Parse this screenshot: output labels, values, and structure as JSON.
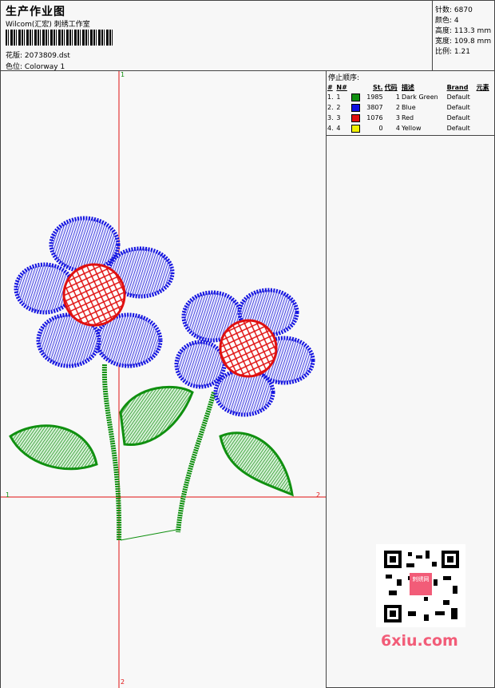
{
  "header": {
    "title": "生产作业图",
    "subtitle": "Wilcom(汇宏) 刺绣工作室",
    "design_label": "花版:",
    "design_value": "2073809.dst",
    "colorway_label": "色位:",
    "colorway_value": "Colorway 1"
  },
  "stats": [
    {
      "label": "针数:",
      "value": "6870"
    },
    {
      "label": "颜色:",
      "value": "4"
    },
    {
      "label": "高度:",
      "value": "113.3 mm"
    },
    {
      "label": "宽度:",
      "value": "109.8 mm"
    },
    {
      "label": "比例:",
      "value": "1.21"
    }
  ],
  "canvas": {
    "marker_1": "1",
    "marker_2": "2"
  },
  "stop_sequence": {
    "title": "停止顺序:",
    "columns": [
      "#",
      "N#",
      "St.",
      "代码",
      "描述",
      "Brand",
      "元素"
    ],
    "rows": [
      {
        "idx": "1.",
        "n": "1",
        "color": "#109010",
        "st": "1985",
        "code": "1",
        "desc": "Dark Green",
        "brand": "Default"
      },
      {
        "idx": "2.",
        "n": "2",
        "color": "#1010e0",
        "st": "3807",
        "code": "2",
        "desc": "Blue",
        "brand": "Default"
      },
      {
        "idx": "3.",
        "n": "3",
        "color": "#e01010",
        "st": "1076",
        "code": "3",
        "desc": "Red",
        "brand": "Default"
      },
      {
        "idx": "4.",
        "n": "4",
        "color": "#f0f000",
        "st": "0",
        "code": "4",
        "desc": "Yellow",
        "brand": "Default"
      }
    ]
  },
  "watermark": {
    "text": "6xiu.com",
    "seal": "刺绣网"
  }
}
